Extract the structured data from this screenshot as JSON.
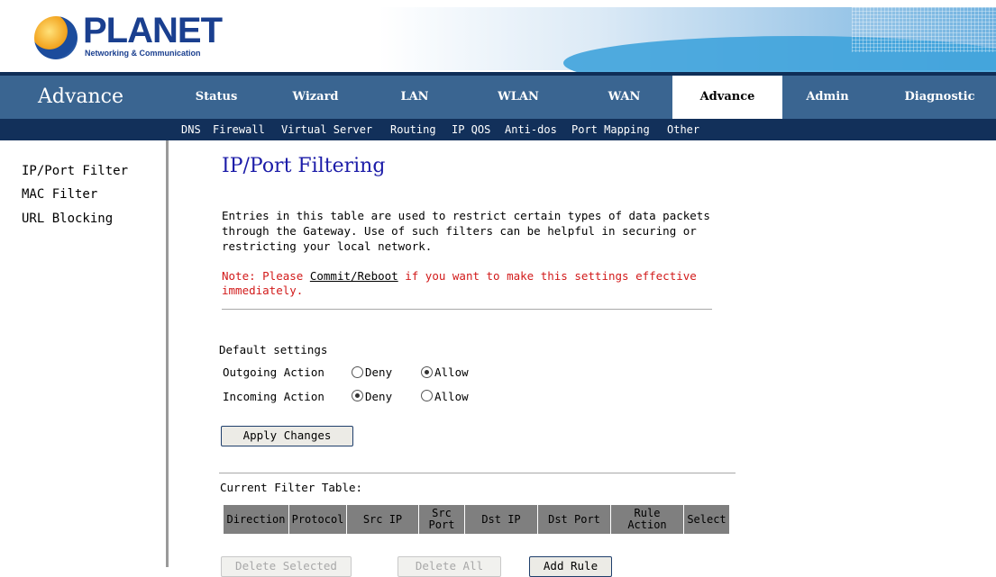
{
  "header": {
    "logo_text": "PLANET",
    "logo_subtitle": "Networking & Communication"
  },
  "nav": {
    "section_title": "Advance",
    "tabs": [
      {
        "label": "Status"
      },
      {
        "label": "Wizard"
      },
      {
        "label": "LAN"
      },
      {
        "label": "WLAN"
      },
      {
        "label": "WAN"
      },
      {
        "label": "Advance",
        "active": true
      },
      {
        "label": "Admin"
      },
      {
        "label": "Diagnostic"
      }
    ]
  },
  "subnav": {
    "items": [
      "DNS",
      "Firewall",
      "Virtual Server",
      "Routing",
      "IP QOS",
      "Anti-dos",
      "Port Mapping",
      "Other"
    ]
  },
  "sidebar": {
    "items": [
      "IP/Port Filter",
      "MAC Filter",
      "URL Blocking"
    ]
  },
  "content": {
    "title": "IP/Port Filtering",
    "description": "Entries in this table are used to restrict certain types of data packets through the Gateway. Use of such filters can be helpful in securing or restricting your local network.",
    "note_prefix": "Note: Please ",
    "note_link": "Commit/Reboot",
    "note_suffix": " if you want to make this settings effective immediately.",
    "default_settings_label": "Default settings",
    "outgoing": {
      "label": "Outgoing Action",
      "deny": "Deny",
      "allow": "Allow",
      "selected": "Allow"
    },
    "incoming": {
      "label": "Incoming Action",
      "deny": "Deny",
      "allow": "Allow",
      "selected": "Deny"
    },
    "apply_button": "Apply Changes",
    "table_label": "Current Filter Table:",
    "table_headers": [
      {
        "l1": "Direction",
        "l2": ""
      },
      {
        "l1": "Protocol",
        "l2": ""
      },
      {
        "l1": "Src IP",
        "l2": ""
      },
      {
        "l1": "Src",
        "l2": "Port"
      },
      {
        "l1": "Dst IP",
        "l2": ""
      },
      {
        "l1": "Dst Port",
        "l2": ""
      },
      {
        "l1": "Rule",
        "l2": "Action"
      },
      {
        "l1": "Select",
        "l2": ""
      }
    ],
    "delete_selected_button": "Delete Selected",
    "delete_all_button": "Delete All",
    "add_rule_button": "Add Rule"
  },
  "colors": {
    "nav_bg": "#3a6591",
    "subnav_bg": "#12305a",
    "title": "#1c1ca8",
    "note": "#d21a1a"
  }
}
